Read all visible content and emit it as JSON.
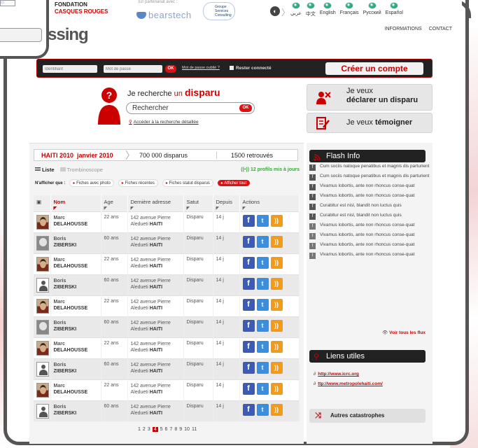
{
  "partners": {
    "note": "En partenariat avec :",
    "fondation_line1": "FONDATION",
    "fondation_line2": "CASQUES ROUGES",
    "bearstech": "bearstech",
    "gsc_line1": "Groupe",
    "gsc_line2": "Services",
    "gsc_line3": "Consulting"
  },
  "languages": [
    {
      "label": "عربي"
    },
    {
      "label": "中文"
    },
    {
      "label": "English"
    },
    {
      "label": "Français"
    },
    {
      "label": "Русский"
    },
    {
      "label": "Español"
    }
  ],
  "header": {
    "logo_text": "ssing",
    "nav": [
      "INFORMATIONS",
      "CONTACT"
    ]
  },
  "login": {
    "id_placeholder": "Identifiant",
    "pwd_placeholder": "Mot de passe",
    "ok_label": "OK",
    "forgot_label": "Mot de passe oublié ?",
    "remember_label": "Rester connecté",
    "create_label": "Créer un compte"
  },
  "search": {
    "title_prefix": "Je recherche",
    "title_un": "un",
    "title_strong": "disparu",
    "input_value": "Rechercher",
    "ok_label": "OK",
    "advanced_label": "Accéder à la recherche détaillée"
  },
  "actions": {
    "declare_line1": "Je veux",
    "declare_line2": "déclarer un disparu",
    "testify_prefix": "Je veux",
    "testify_strong": "témoigner"
  },
  "stats": {
    "event": "HAITI 2010",
    "date": "janvier 2010",
    "missing": "700 000 disparus",
    "found": "1500 retrouvés"
  },
  "views": {
    "list": "Liste",
    "trombi": "Trombinoscope",
    "updates": "((•)) 12 profils mis à jours"
  },
  "filters": {
    "label": "N'afficher que :",
    "items": [
      "Fiches avec photo",
      "Fiches récentes",
      "Fiches statut disparus"
    ],
    "all": "▸ Afficher tout"
  },
  "table": {
    "headers": [
      "",
      "Nom",
      "Age",
      "Dernière adresse",
      "Satut",
      "Depuis",
      "Actions"
    ],
    "rows": [
      {
        "first": "Marc",
        "last": "DELAHOUSSE",
        "age": "22 ans",
        "addr1": "142 avenue Pierre",
        "addr2": "Aledueti",
        "country": "HAITI",
        "status": "Disparu",
        "since": "14 j",
        "avatar": "photo"
      },
      {
        "first": "Boris",
        "last": "ZIBERSKI",
        "age": "60 ans",
        "addr1": "142 avenue Pierre",
        "addr2": "Aledueti",
        "country": "HAITI",
        "status": "Disparu",
        "since": "14 j",
        "avatar": "photo2"
      },
      {
        "first": "Marc",
        "last": "DELAHOUSSE",
        "age": "22 ans",
        "addr1": "142 avenue Pierre",
        "addr2": "Aledueti",
        "country": "HAITI",
        "status": "Disparu",
        "since": "14 j",
        "avatar": "photo"
      },
      {
        "first": "Boris",
        "last": "ZIBERSKI",
        "age": "60 ans",
        "addr1": "142 avenue Pierre",
        "addr2": "Aledueti",
        "country": "HAITI",
        "status": "Disparu",
        "since": "14 j",
        "avatar": "anon"
      },
      {
        "first": "Marc",
        "last": "DELAHOUSSE",
        "age": "22 ans",
        "addr1": "142 avenue Pierre",
        "addr2": "Aledueti",
        "country": "HAITI",
        "status": "Disparu",
        "since": "14 j",
        "avatar": "photo"
      },
      {
        "first": "Boris",
        "last": "ZIBERSKI",
        "age": "60 ans",
        "addr1": "142 avenue Pierre",
        "addr2": "Aledueti",
        "country": "HAITI",
        "status": "Disparu",
        "since": "14 j",
        "avatar": "photo2"
      },
      {
        "first": "Marc",
        "last": "DELAHOUSSE",
        "age": "22 ans",
        "addr1": "142 avenue Pierre",
        "addr2": "Aledueti",
        "country": "HAITI",
        "status": "Disparu",
        "since": "14 j",
        "avatar": "photo"
      },
      {
        "first": "Boris",
        "last": "ZIBERSKI",
        "age": "60 ans",
        "addr1": "142 avenue Pierre",
        "addr2": "Aledueti",
        "country": "HAITI",
        "status": "Disparu",
        "since": "14 j",
        "avatar": "anon"
      },
      {
        "first": "Marc",
        "last": "DELAHOUSSE",
        "age": "22 ans",
        "addr1": "142 avenue Pierre",
        "addr2": "Aledueti",
        "country": "HAITI",
        "status": "Disparu",
        "since": "14 j",
        "avatar": "photo"
      },
      {
        "first": "Boris",
        "last": "ZIBERSKI",
        "age": "60 ans",
        "addr1": "142 avenue Pierre",
        "addr2": "Aledueti",
        "country": "HAITI",
        "status": "Disparu",
        "since": "14 j",
        "avatar": "anon"
      }
    ]
  },
  "pager": {
    "pages": [
      "1",
      "2",
      "3",
      "4",
      "5",
      "6",
      "7",
      "8",
      "9",
      "10",
      "11"
    ],
    "current": "4"
  },
  "flash": {
    "title": "Flash Info",
    "items": [
      {
        "icon": "f",
        "text": "Cum sociis natoque penatibus et magnis dis parturient"
      },
      {
        "icon": "f",
        "text": "Cum sociis natoque penatibus et magnis dis parturient"
      },
      {
        "icon": "f",
        "text": "Vivamus lobortis, ante non rhoncus conse-quat"
      },
      {
        "icon": "f",
        "text": "Vivamus lobortis, ante non rhoncus conse-quat"
      },
      {
        "icon": "f",
        "text": "Curabitur est nisl, blandit non luctus quis"
      },
      {
        "icon": "f",
        "text": "Curabitur est nisl, blandit non luctus quis"
      },
      {
        "icon": "t",
        "text": "Vivamus lobortis, ante non rhoncus conse-quat"
      },
      {
        "icon": "t",
        "text": "Vivamus lobortis, ante non rhoncus conse-quat"
      },
      {
        "icon": "t",
        "text": "Vivamus lobortis, ante non rhoncus conse-quat"
      },
      {
        "icon": "t",
        "text": "Vivamus lobortis, ante non rhoncus conse-quat"
      }
    ],
    "all_label": "Voir tous les flux"
  },
  "liens": {
    "title": "Liens utiles",
    "links": [
      "http://www.icrc.org",
      "ttp://www.metropolehaiti.com/"
    ]
  },
  "catastrophes": {
    "label": "Autres catastrophes"
  },
  "colors": {
    "accent": "#cc0000",
    "dark": "#222222"
  }
}
